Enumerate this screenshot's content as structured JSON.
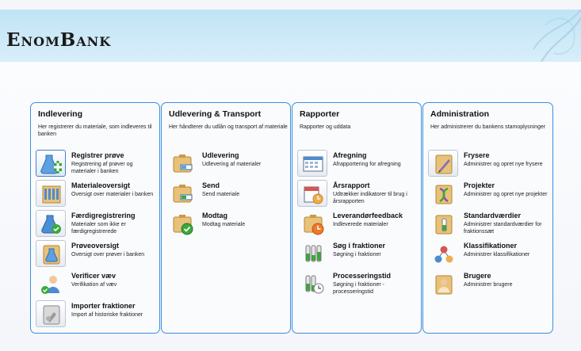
{
  "app": {
    "logo": "EnomBank"
  },
  "panels": [
    {
      "title": "Indlevering",
      "desc": "Her registrerer du materiale, som indleveres til banken",
      "items": [
        {
          "title": "Registrer prøve",
          "desc": "Registrering af prøver og materialer i banken",
          "icon": "register-sample-icon"
        },
        {
          "title": "Materialeoversigt",
          "desc": "Oversigt over materialer i banken",
          "icon": "material-overview-icon"
        },
        {
          "title": "Færdigregistrering",
          "desc": "Materialer som ikke er færdigregistrerede",
          "icon": "complete-registration-icon"
        },
        {
          "title": "Prøveoversigt",
          "desc": "Oversigt over prøver i banken",
          "icon": "sample-overview-icon"
        },
        {
          "title": "Verificer væv",
          "desc": "Verifikation af væv",
          "icon": "verify-tissue-icon"
        },
        {
          "title": "Importer fraktioner",
          "desc": "Import af historiske fraktioner",
          "icon": "import-fractions-icon"
        }
      ]
    },
    {
      "title": "Udlevering & Transport",
      "desc": "Her håndterer du udlån og transport af materiale",
      "items": [
        {
          "title": "Udlevering",
          "desc": "Udlevering af materialer",
          "icon": "delivery-icon"
        },
        {
          "title": "Send",
          "desc": "Send materiale",
          "icon": "send-icon"
        },
        {
          "title": "Modtag",
          "desc": "Modtag materiale",
          "icon": "receive-icon"
        }
      ]
    },
    {
      "title": "Rapporter",
      "desc": "Rapporter og uddata",
      "items": [
        {
          "title": "Afregning",
          "desc": "Afrapportering for afregning",
          "icon": "settlement-icon"
        },
        {
          "title": "Årsrapport",
          "desc": "Udtrækker indikatorer til brug i årsrapporten",
          "icon": "annual-report-icon"
        },
        {
          "title": "Leverandørfeedback",
          "desc": "Indleverede materialer",
          "icon": "supplier-feedback-icon"
        },
        {
          "title": "Søg i fraktioner",
          "desc": "Søgning i fraktioner",
          "icon": "search-fractions-icon"
        },
        {
          "title": "Processeringstid",
          "desc": "Søgning i fraktioner - processeringstid",
          "icon": "processing-time-icon"
        }
      ]
    },
    {
      "title": "Administration",
      "desc": "Her administrerer du bankens stamoplysninger",
      "items": [
        {
          "title": "Frysere",
          "desc": "Administrer og opret nye frysere",
          "icon": "freezers-icon"
        },
        {
          "title": "Projekter",
          "desc": "Administrer og opret nye projekter",
          "icon": "projects-icon"
        },
        {
          "title": "Standardværdier",
          "desc": "Administrer standardværdier for fraktionssæt",
          "icon": "default-values-icon"
        },
        {
          "title": "Klassifikationer",
          "desc": "Administrer klassifikationer",
          "icon": "classifications-icon"
        },
        {
          "title": "Brugere",
          "desc": "Administrer brugere",
          "icon": "users-icon"
        }
      ]
    }
  ]
}
